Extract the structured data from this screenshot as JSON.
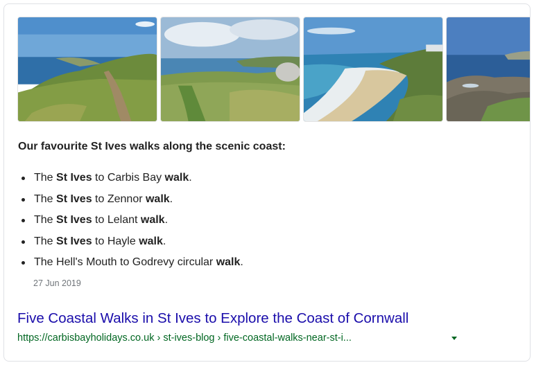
{
  "images": [
    {
      "alt": "coastal-path-image"
    },
    {
      "alt": "grass-path-image"
    },
    {
      "alt": "sandy-beach-image"
    },
    {
      "alt": "rocky-coast-image"
    }
  ],
  "result": {
    "heading": "Our favourite St Ives walks along the scenic coast:",
    "items": [
      {
        "pre": "The ",
        "bold1": "St Ives",
        "mid": " to Carbis Bay ",
        "bold2": "walk",
        "post": "."
      },
      {
        "pre": "The ",
        "bold1": "St Ives",
        "mid": " to Zennor ",
        "bold2": "walk",
        "post": "."
      },
      {
        "pre": "The ",
        "bold1": "St Ives",
        "mid": " to Lelant ",
        "bold2": "walk",
        "post": "."
      },
      {
        "pre": "The ",
        "bold1": "St Ives",
        "mid": " to Hayle ",
        "bold2": "walk",
        "post": "."
      },
      {
        "pre": "The Hell's Mouth to Godrevy circular ",
        "bold1": "",
        "mid": "",
        "bold2": "walk",
        "post": "."
      }
    ],
    "date": "27 Jun 2019",
    "title": "Five Coastal Walks in St Ives to Explore the Coast of Cornwall",
    "url": "https://carbisbayholidays.co.uk › st-ives-blog › five-coastal-walks-near-st-i...",
    "colors": {
      "link": "#1a0dab",
      "url": "#006621",
      "date": "#70757a"
    }
  }
}
